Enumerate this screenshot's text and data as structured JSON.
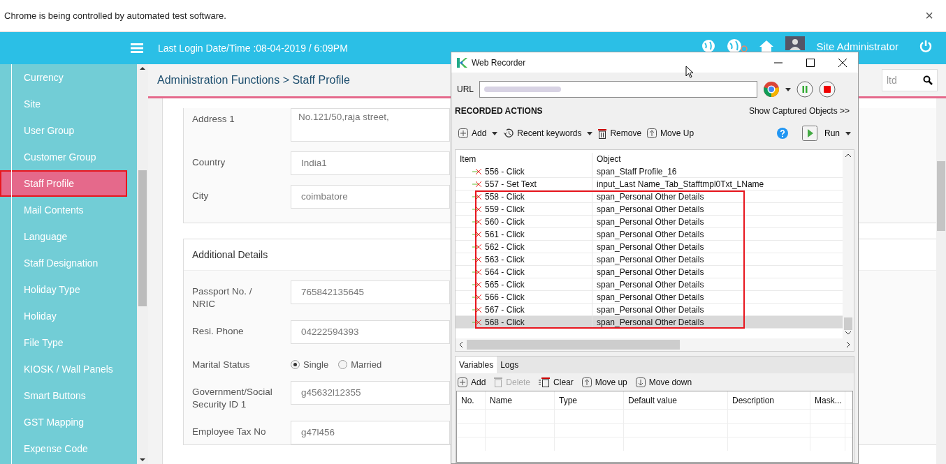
{
  "infobar": {
    "message": "Chrome is being controlled by automated test software.",
    "close": "×"
  },
  "header": {
    "last_login": "Last Login Date/Time :08-04-2019 / 6:09PM",
    "user": "Site Administrator"
  },
  "sidebar": {
    "items": [
      {
        "label": "Currency",
        "selected": false,
        "outlined": false
      },
      {
        "label": "Site",
        "selected": false,
        "outlined": false
      },
      {
        "label": "User Group",
        "selected": false,
        "outlined": false
      },
      {
        "label": "Customer Group",
        "selected": false,
        "outlined": false
      },
      {
        "label": "Staff Profile",
        "selected": true,
        "outlined": true
      },
      {
        "label": "Mail Contents",
        "selected": false,
        "outlined": false
      },
      {
        "label": "Language",
        "selected": false,
        "outlined": false
      },
      {
        "label": "Staff Designation",
        "selected": false,
        "outlined": false
      },
      {
        "label": "Holiday Type",
        "selected": false,
        "outlined": false
      },
      {
        "label": "Holiday",
        "selected": false,
        "outlined": false
      },
      {
        "label": "File Type",
        "selected": false,
        "outlined": false
      },
      {
        "label": "KIOSK / Wall Panels",
        "selected": false,
        "outlined": false
      },
      {
        "label": "Smart Buttons",
        "selected": false,
        "outlined": false
      },
      {
        "label": "GST Mapping",
        "selected": false,
        "outlined": false
      },
      {
        "label": "Expense Code",
        "selected": false,
        "outlined": false
      }
    ]
  },
  "breadcrumb": "Administration Functions > Staff Profile",
  "search": {
    "placeholder": "ltd"
  },
  "address_section": {
    "fields": [
      {
        "label": "Address 1",
        "value": "No.121/50,raja street,",
        "kind": "textarea"
      },
      {
        "label": "Country",
        "value": "India1",
        "kind": "input"
      },
      {
        "label": "City",
        "value": "coimbatore",
        "kind": "input"
      }
    ]
  },
  "additional_details": {
    "title": "Additional Details",
    "fields": [
      {
        "label": "Passport No. / NRIC",
        "value": "765842135645",
        "kind": "input"
      },
      {
        "label": "Resi. Phone",
        "value": "04222594393",
        "kind": "input"
      },
      {
        "label": "Marital Status",
        "kind": "radio",
        "options": [
          {
            "label": "Single",
            "selected": true
          },
          {
            "label": "Married",
            "selected": false
          }
        ]
      },
      {
        "label": "Government/Social Security ID 1",
        "value": "g45632l12355",
        "kind": "input"
      },
      {
        "label": "Employee Tax No",
        "value": "g47l456",
        "kind": "input"
      }
    ]
  },
  "recorder": {
    "title": "Web Recorder",
    "url_label": "URL",
    "section_title": "RECORDED ACTIONS",
    "show_objects": "Show Captured Objects >>",
    "toolbar": [
      "Add",
      "Recent keywords",
      "Remove",
      "Move Up"
    ],
    "run": "Run",
    "columns": [
      "Item",
      "Object"
    ],
    "rows": [
      {
        "item": "556 - Click",
        "object": "span_Staff Profile_16",
        "selected": false,
        "marked": false
      },
      {
        "item": "557 - Set Text",
        "object": "input_Last Name_Tab_Stafftmpl0Txt_LName",
        "selected": false,
        "marked": false
      },
      {
        "item": "558 - Click",
        "object": "span_Personal  Other Details",
        "selected": false,
        "marked": true
      },
      {
        "item": "559 - Click",
        "object": "span_Personal  Other Details",
        "selected": false,
        "marked": true
      },
      {
        "item": "560 - Click",
        "object": "span_Personal  Other Details",
        "selected": false,
        "marked": true
      },
      {
        "item": "561 - Click",
        "object": "span_Personal  Other Details",
        "selected": false,
        "marked": true
      },
      {
        "item": "562 - Click",
        "object": "span_Personal  Other Details",
        "selected": false,
        "marked": true
      },
      {
        "item": "563 - Click",
        "object": "span_Personal  Other Details",
        "selected": false,
        "marked": true
      },
      {
        "item": "564 - Click",
        "object": "span_Personal  Other Details",
        "selected": false,
        "marked": true
      },
      {
        "item": "565 - Click",
        "object": "span_Personal  Other Details",
        "selected": false,
        "marked": true
      },
      {
        "item": "566 - Click",
        "object": "span_Personal  Other Details",
        "selected": false,
        "marked": true
      },
      {
        "item": "567 - Click",
        "object": "span_Personal  Other Details",
        "selected": false,
        "marked": true
      },
      {
        "item": "568 - Click",
        "object": "span_Personal  Other Details",
        "selected": true,
        "marked": true
      }
    ],
    "tabs": [
      {
        "label": "Variables",
        "selected": true
      },
      {
        "label": "Logs",
        "selected": false
      }
    ],
    "var_toolbar": [
      {
        "label": "Add",
        "kind": "add",
        "disabled": false
      },
      {
        "label": "Delete",
        "kind": "delete",
        "disabled": true
      },
      {
        "label": "Clear",
        "kind": "clear",
        "disabled": false
      },
      {
        "label": "Move up",
        "kind": "up",
        "disabled": false
      },
      {
        "label": "Move down",
        "kind": "down",
        "disabled": false
      }
    ],
    "var_columns": [
      "No.",
      "Name",
      "Type",
      "Default value",
      "Description",
      "Mask..."
    ]
  }
}
